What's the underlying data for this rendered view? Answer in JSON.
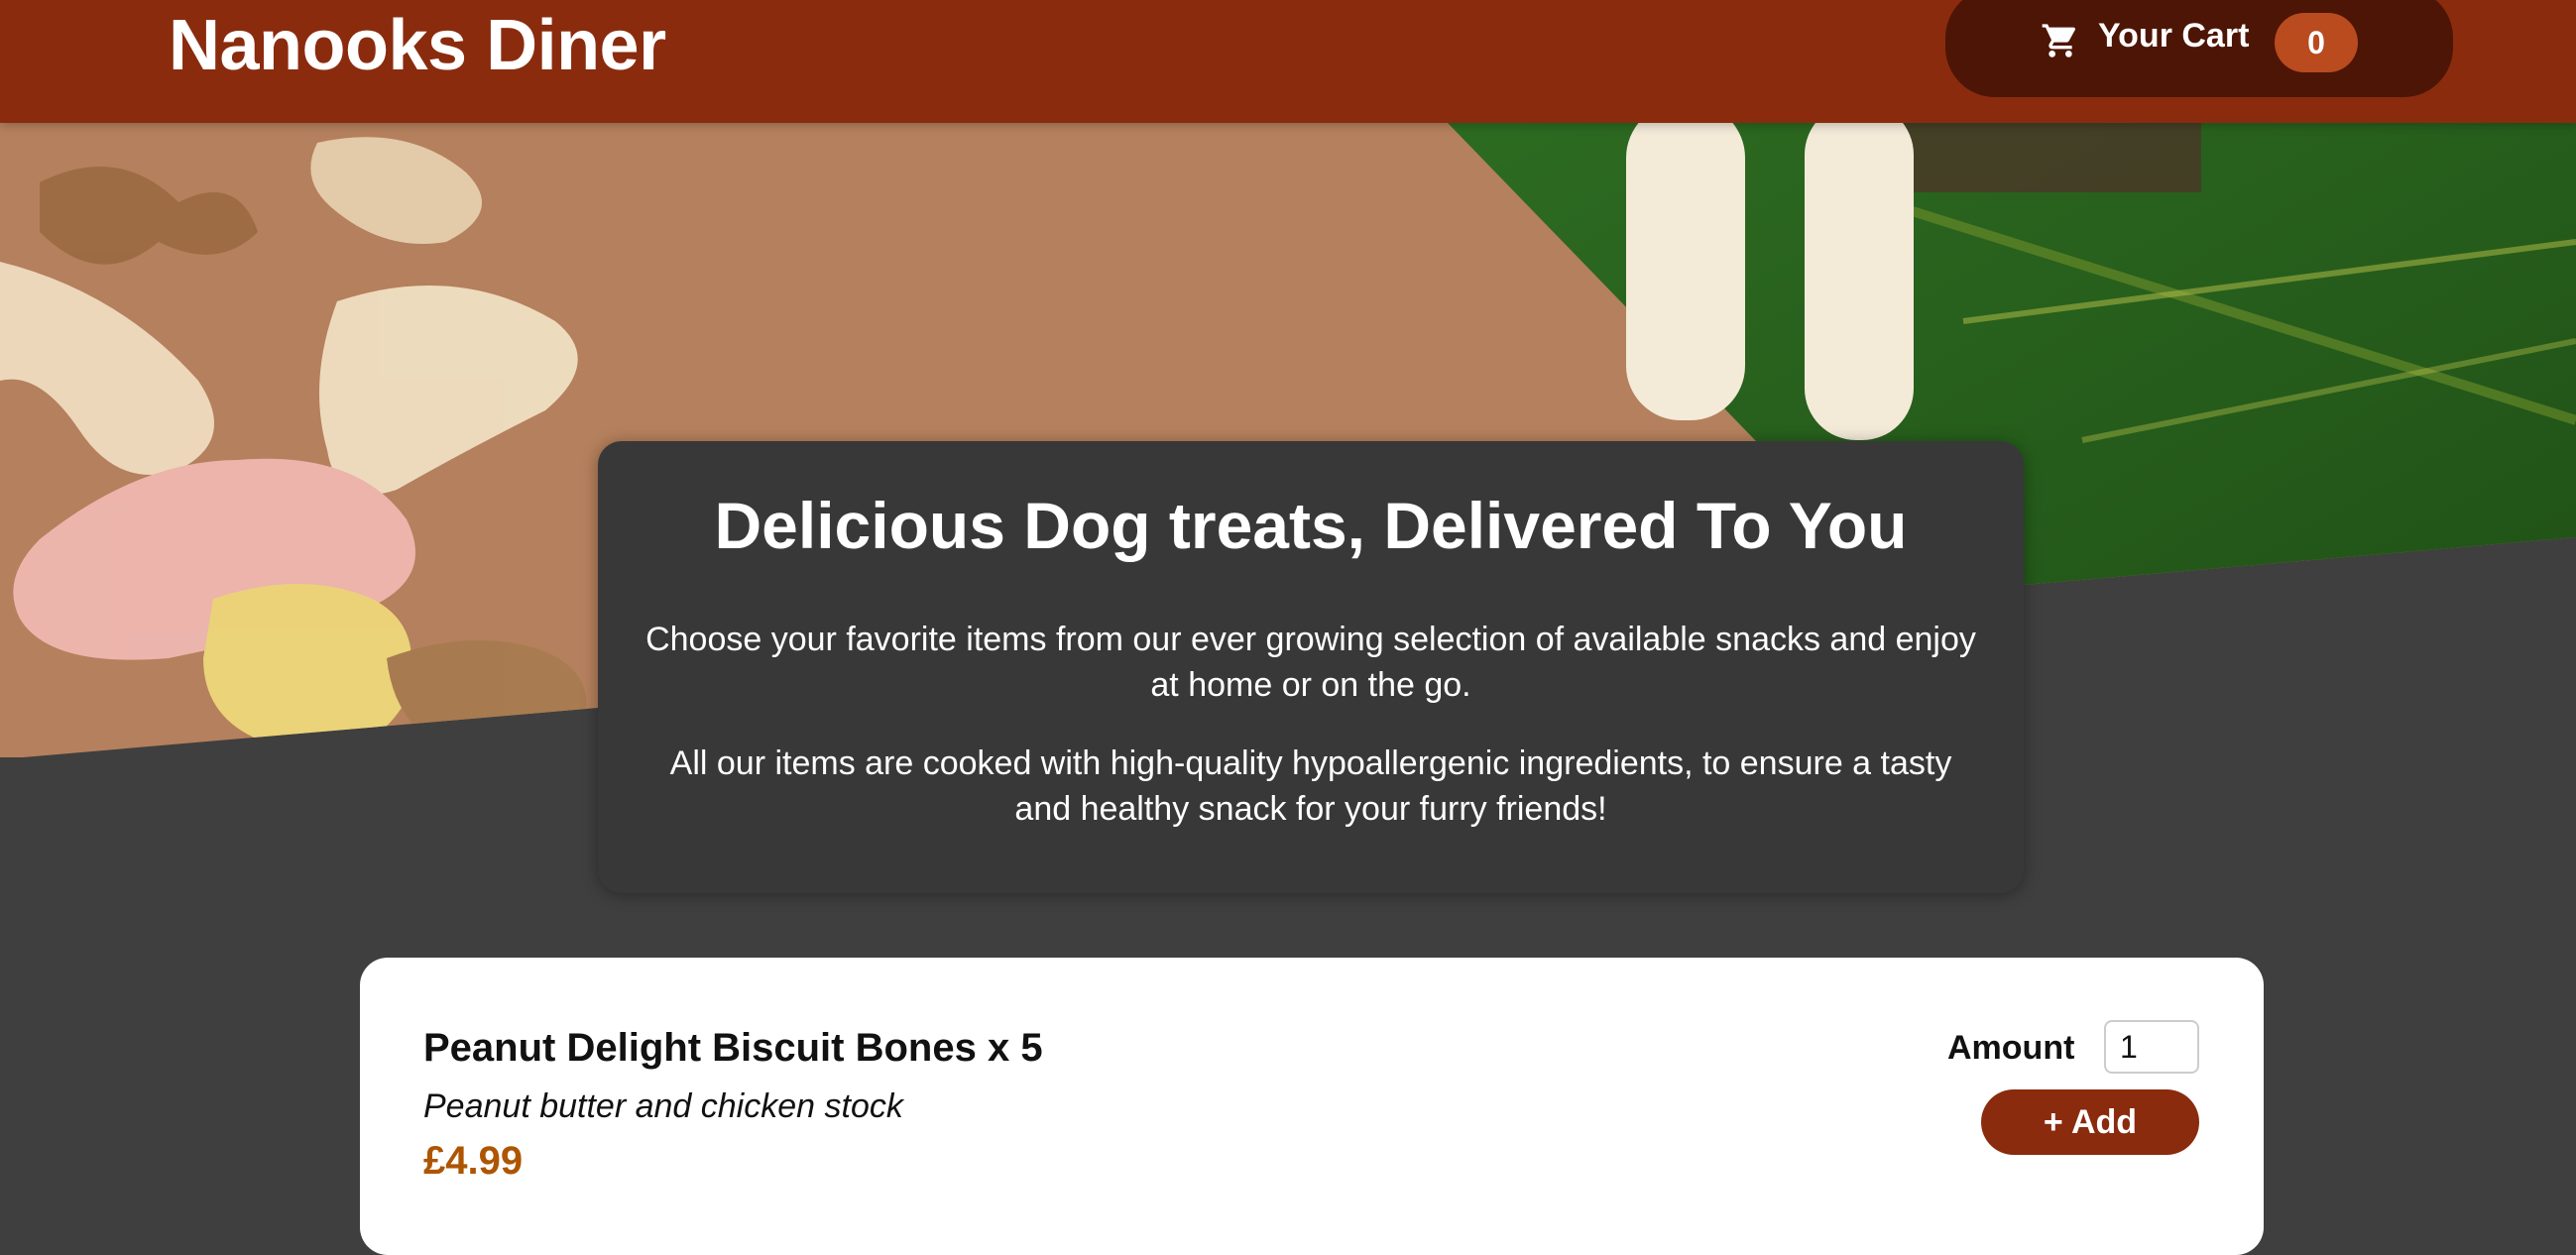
{
  "header": {
    "title": "Nanooks Diner",
    "cart": {
      "icon": "cart-icon",
      "label": "Your Cart",
      "count": "0"
    }
  },
  "hero": {
    "image": "dog-treats-on-table"
  },
  "summary": {
    "title": "Delicious Dog treats, Delivered To You",
    "paragraph1": "Choose your favorite items from our ever growing selection of available snacks and enjoy at home or on the go.",
    "paragraph2": "All our items are cooked with high-quality hypoallergenic ingredients, to ensure a tasty and healthy snack for your furry friends!"
  },
  "meals": [
    {
      "name": "Peanut Delight Biscuit Bones x 5",
      "description": "Peanut butter and chicken stock",
      "price": "£4.99",
      "amount_label": "Amount",
      "amount_value": "1",
      "add_label": "+ Add"
    }
  ],
  "colors": {
    "header": "#8a2b0e",
    "cart_button": "#4d1505",
    "badge": "#b94b1f",
    "price": "#ad5502",
    "background": "#3f3f3f"
  }
}
